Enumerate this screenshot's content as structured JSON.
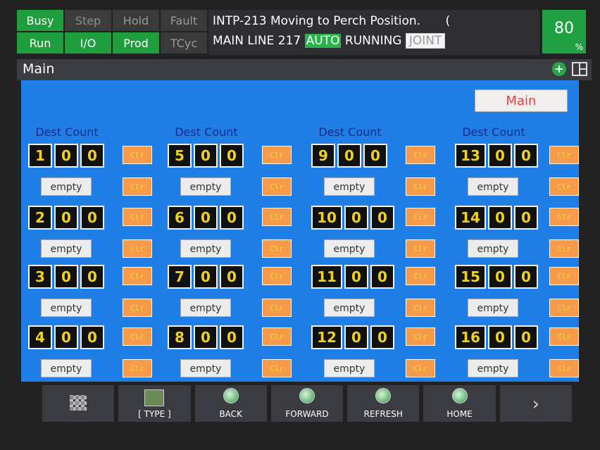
{
  "status": {
    "row1": [
      "Busy",
      "Step",
      "Hold",
      "Fault"
    ],
    "row2": [
      "Run",
      "I/O",
      "Prod",
      "TCyc"
    ]
  },
  "message": {
    "line1": "INTP-213 Moving to Perch Position.",
    "line1_tail": "(",
    "line2_prefix": "MAIN LINE 217",
    "mode": "AUTO",
    "state": "RUNNING",
    "coord": "JOINT"
  },
  "override": {
    "value": "80",
    "unit": "%"
  },
  "title": "Main",
  "panel": {
    "main_button": "Main",
    "header": "Dest Count",
    "clr_label": "Clr",
    "empty_label": "empty",
    "rows": [
      [
        [
          "1",
          "0",
          "0"
        ],
        [
          "5",
          "0",
          "0"
        ],
        [
          "9",
          "0",
          "0"
        ],
        [
          "13",
          "0",
          "0"
        ]
      ],
      [
        [
          "2",
          "0",
          "0"
        ],
        [
          "6",
          "0",
          "0"
        ],
        [
          "10",
          "0",
          "0"
        ],
        [
          "14",
          "0",
          "0"
        ]
      ],
      [
        [
          "3",
          "0",
          "0"
        ],
        [
          "7",
          "0",
          "0"
        ],
        [
          "11",
          "0",
          "0"
        ],
        [
          "15",
          "0",
          "0"
        ]
      ],
      [
        [
          "4",
          "0",
          "0"
        ],
        [
          "8",
          "0",
          "0"
        ],
        [
          "12",
          "0",
          "0"
        ],
        [
          "16",
          "0",
          "0"
        ]
      ]
    ]
  },
  "nav": [
    {
      "label": "",
      "icon": "grid-icon"
    },
    {
      "label": "[ TYPE ]",
      "icon": "type-icon"
    },
    {
      "label": "BACK",
      "icon": "globe-icon"
    },
    {
      "label": "FORWARD",
      "icon": "globe-icon"
    },
    {
      "label": "REFRESH",
      "icon": "globe-icon"
    },
    {
      "label": "HOME",
      "icon": "globe-icon"
    },
    {
      "label": "",
      "icon": "chevron-right-icon"
    }
  ],
  "colors": {
    "panel_bg": "#1f7fe6",
    "status_on": "#1f9e3d",
    "clr_bg": "#f79a4a",
    "digit_text": "#f0d21a"
  }
}
